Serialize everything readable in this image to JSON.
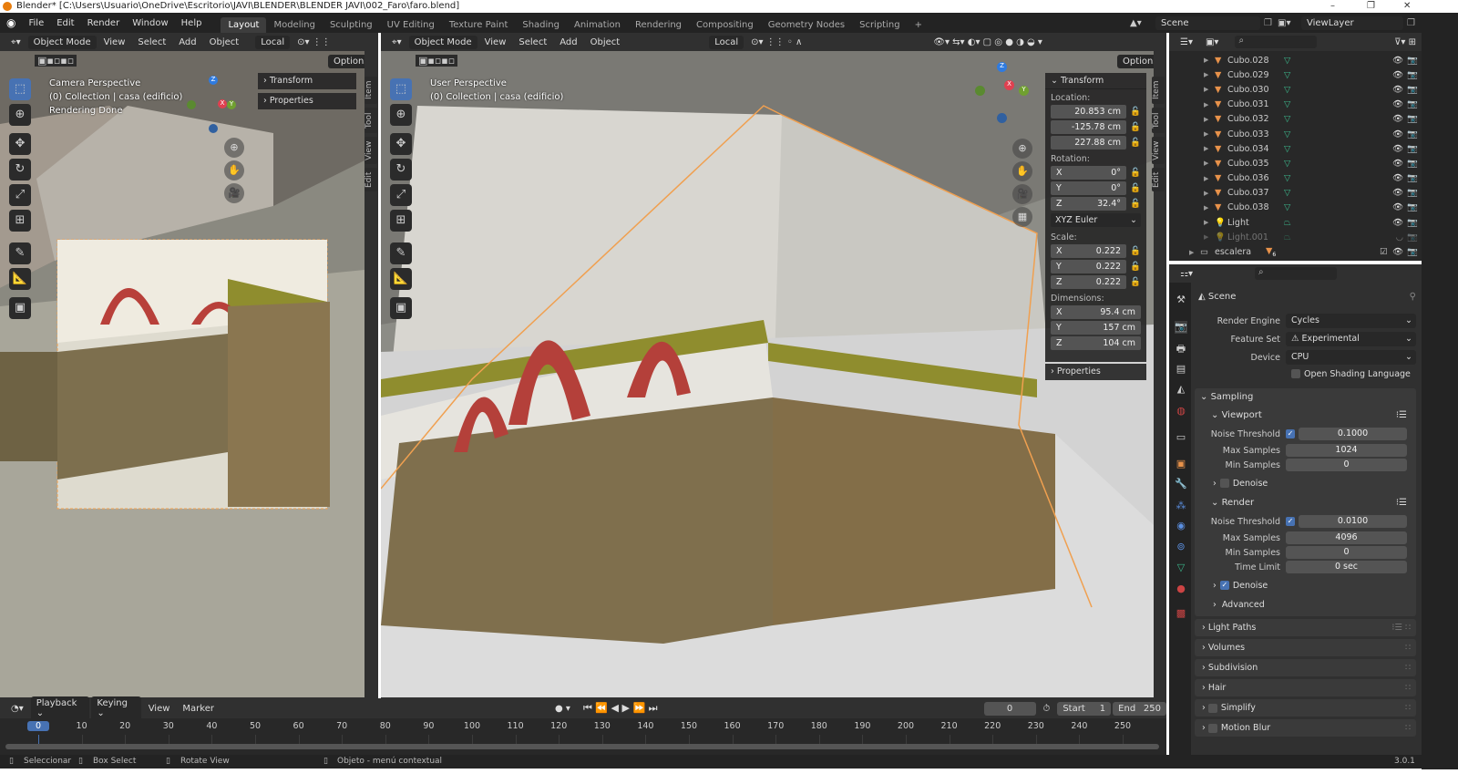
{
  "window": {
    "title": "Blender* [C:\\Users\\Usuario\\OneDrive\\Escritorio\\JAVI\\BLENDER\\BLENDER JAVI\\002_Faro\\faro.blend]",
    "minimize": "–",
    "maximize": "❐",
    "close": "✕"
  },
  "menu": {
    "items": [
      "File",
      "Edit",
      "Render",
      "Window",
      "Help"
    ],
    "workspaces": [
      "Layout",
      "Modeling",
      "Sculpting",
      "UV Editing",
      "Texture Paint",
      "Shading",
      "Animation",
      "Rendering",
      "Compositing",
      "Geometry Nodes",
      "Scripting",
      "+"
    ],
    "active_workspace": "Layout",
    "scene": "Scene",
    "view_layer": "ViewLayer"
  },
  "viewport_left": {
    "mode": "Object Mode",
    "menus": [
      "View",
      "Select",
      "Add",
      "Object"
    ],
    "orientation": "Local",
    "options": "Options",
    "overlay": [
      "Camera Perspective",
      "(0) Collection | casa (edificio)",
      "Rendering Done"
    ],
    "panels": [
      "Transform",
      "Properties"
    ],
    "tabs": [
      "Item",
      "Tool",
      "View",
      "Edit"
    ]
  },
  "viewport_right": {
    "mode": "Object Mode",
    "menus": [
      "View",
      "Select",
      "Add",
      "Object"
    ],
    "orientation": "Local",
    "options": "Options",
    "overlay": [
      "User Perspective",
      "(0) Collection | casa (edificio)"
    ],
    "tabs": [
      "Item",
      "Tool",
      "View",
      "Edit"
    ],
    "transform": {
      "title": "Transform",
      "location_label": "Location:",
      "location": [
        "20.853 cm",
        "-125.78 cm",
        "227.88 cm"
      ],
      "rotation_label": "Rotation:",
      "rotation": [
        {
          "axis": "X",
          "value": "0°"
        },
        {
          "axis": "Y",
          "value": "0°"
        },
        {
          "axis": "Z",
          "value": "32.4°"
        }
      ],
      "rotation_mode": "XYZ Euler",
      "scale_label": "Scale:",
      "scale": [
        {
          "axis": "X",
          "value": "0.222"
        },
        {
          "axis": "Y",
          "value": "0.222"
        },
        {
          "axis": "Z",
          "value": "0.222"
        }
      ],
      "dimensions_label": "Dimensions:",
      "dimensions": [
        {
          "axis": "X",
          "value": "95.4 cm"
        },
        {
          "axis": "Y",
          "value": "157 cm"
        },
        {
          "axis": "Z",
          "value": "104 cm"
        }
      ],
      "properties": "Properties"
    }
  },
  "gizmo": {
    "x": "X",
    "y": "Y",
    "z": "Z"
  },
  "outliner": {
    "items": [
      {
        "name": "Cubo.028",
        "type": "mesh"
      },
      {
        "name": "Cubo.029",
        "type": "mesh"
      },
      {
        "name": "Cubo.030",
        "type": "mesh"
      },
      {
        "name": "Cubo.031",
        "type": "mesh"
      },
      {
        "name": "Cubo.032",
        "type": "mesh"
      },
      {
        "name": "Cubo.033",
        "type": "mesh"
      },
      {
        "name": "Cubo.034",
        "type": "mesh"
      },
      {
        "name": "Cubo.035",
        "type": "mesh"
      },
      {
        "name": "Cubo.036",
        "type": "mesh"
      },
      {
        "name": "Cubo.037",
        "type": "mesh"
      },
      {
        "name": "Cubo.038",
        "type": "mesh"
      },
      {
        "name": "Light",
        "type": "light"
      },
      {
        "name": "Light.001",
        "type": "light",
        "hidden": true
      }
    ],
    "collection": {
      "name": "escalera",
      "count": "6"
    }
  },
  "properties": {
    "context": "Scene",
    "render_engine_label": "Render Engine",
    "render_engine": "Cycles",
    "feature_set_label": "Feature Set",
    "feature_set": "Experimental",
    "device_label": "Device",
    "device": "CPU",
    "osl": "Open Shading Language",
    "sampling": "Sampling",
    "viewport": "Viewport",
    "render": "Render",
    "vp_noise_label": "Noise Threshold",
    "vp_noise": "0.1000",
    "vp_max_label": "Max Samples",
    "vp_max": "1024",
    "vp_min_label": "Min Samples",
    "vp_min": "0",
    "denoise": "Denoise",
    "r_noise_label": "Noise Threshold",
    "r_noise": "0.0100",
    "r_max_label": "Max Samples",
    "r_max": "4096",
    "r_min_label": "Min Samples",
    "r_min": "0",
    "r_time_label": "Time Limit",
    "r_time": "0 sec",
    "advanced": "Advanced",
    "sections": [
      "Light Paths",
      "Volumes",
      "Subdivision",
      "Hair",
      "Simplify",
      "Motion Blur"
    ]
  },
  "timeline": {
    "menus": [
      "Playback",
      "Keying",
      "View",
      "Marker"
    ],
    "current_frame": "0",
    "start_label": "Start",
    "start": "1",
    "end_label": "End",
    "end": "250",
    "ticks": [
      "0",
      "10",
      "20",
      "30",
      "40",
      "50",
      "60",
      "70",
      "80",
      "90",
      "100",
      "110",
      "120",
      "130",
      "140",
      "150",
      "160",
      "170",
      "180",
      "190",
      "200",
      "210",
      "220",
      "230",
      "240",
      "250"
    ]
  },
  "status": {
    "items": [
      "Seleccionar",
      "Box Select",
      "Rotate View",
      "Objeto - menú contextual"
    ],
    "version": "3.0.1"
  },
  "colors": {
    "accent": "#4772b3",
    "selection_outline": "#f0a050",
    "mesh_icon": "#e8924a",
    "data_icon": "#3bb58a"
  }
}
